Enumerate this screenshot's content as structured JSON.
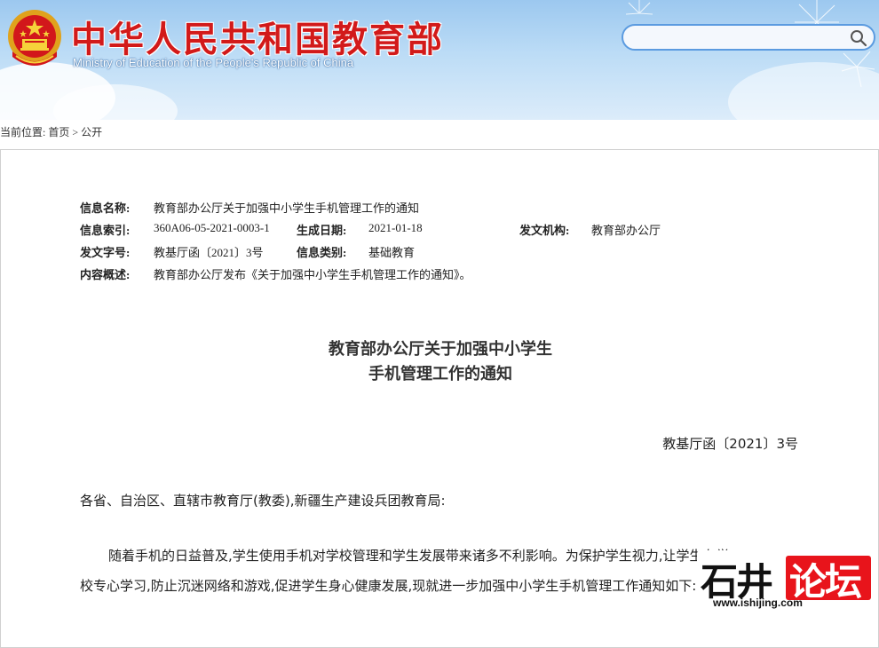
{
  "header": {
    "title": "中华人民共和国教育部",
    "subtitle": "Ministry of Education of the People's Republic of China",
    "search": {
      "value": "",
      "placeholder": ""
    }
  },
  "breadcrumb": {
    "prefix": "当前位置:",
    "home": "首页",
    "separator": ">",
    "current": "公开"
  },
  "meta": {
    "info_name_label": "信息名称:",
    "info_name_value": "教育部办公厅关于加强中小学生手机管理工作的通知",
    "index_label": "信息索引:",
    "index_value": "360A06-05-2021-0003-1",
    "date_label": "生成日期:",
    "date_value": "2021-01-18",
    "issuer_label": "发文机构:",
    "issuer_value": "教育部办公厅",
    "doc_no_label": "发文字号:",
    "doc_no_value": "教基厅函〔2021〕3号",
    "category_label": "信息类别:",
    "category_value": "基础教育",
    "summary_label": "内容概述:",
    "summary_value": "教育部办公厅发布《关于加强中小学生手机管理工作的通知》。"
  },
  "document": {
    "title_line1": "教育部办公厅关于加强中小学生",
    "title_line2": "手机管理工作的通知",
    "doc_number": "教基厅函〔2021〕3号",
    "salutation": "各省、自治区、直辖市教育厅(教委),新疆生产建设兵团教育局:",
    "paragraph_line1": "随着手机的日益普及,学生使用手机对学校管理和学生发展带来诸多不利影响。为保护学生视力,让学生在学",
    "paragraph_line2": "校专心学习,防止沉迷网络和游戏,促进学生身心健康发展,现就进一步加强中小学生手机管理工作通知如下:"
  },
  "watermark": {
    "text_a": "石井",
    "text_b": "论坛",
    "url": "www.ishijing.com"
  },
  "colors": {
    "title_red": "#d21a1a",
    "sky_blue": "#9cc8ef",
    "search_border": "#5b9be0",
    "watermark_red": "#e8141b"
  }
}
